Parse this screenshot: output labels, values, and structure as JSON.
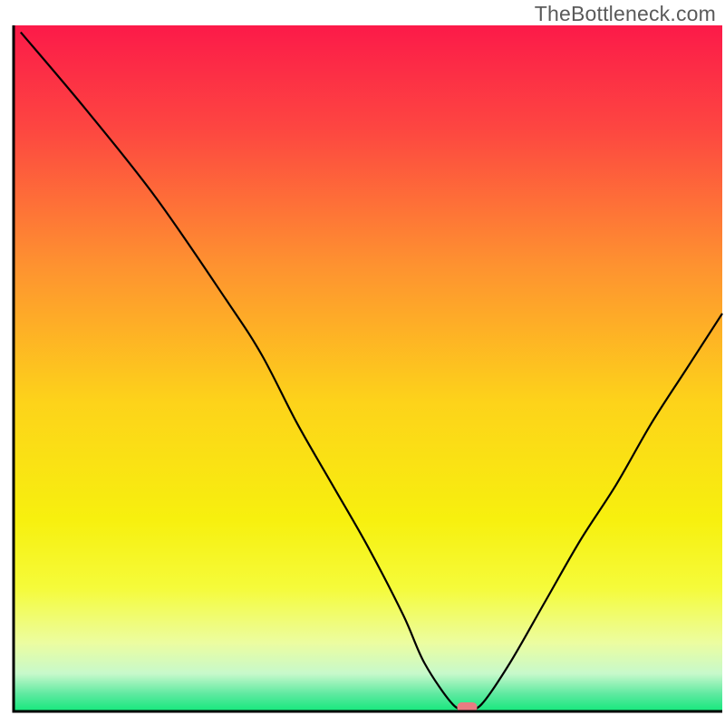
{
  "watermark": "TheBottleneck.com",
  "chart_data": {
    "type": "line",
    "title": "",
    "xlabel": "",
    "ylabel": "",
    "xlim": [
      0,
      100
    ],
    "ylim": [
      0,
      100
    ],
    "grid": false,
    "legend": false,
    "notes": "Background is a vertical gradient from red at top through orange and yellow to green at the very bottom. A single black curve descends from top-left, reaches a flat minimum near x≈62–66 at y≈0, then rises toward the right. A small pink marker sits at the minimum.",
    "series": [
      {
        "name": "curve",
        "x": [
          1,
          10,
          20,
          30,
          35,
          40,
          45,
          50,
          55,
          58,
          62,
          64,
          66,
          70,
          75,
          80,
          85,
          90,
          95,
          100
        ],
        "y": [
          99,
          88,
          75,
          60,
          52,
          42,
          33,
          24,
          14,
          7,
          1,
          0.5,
          1,
          7,
          16,
          25,
          33,
          42,
          50,
          58
        ]
      }
    ],
    "marker": {
      "x": 64,
      "y": 0.6,
      "color": "#e97c82"
    },
    "gradient_stops": [
      {
        "offset": 0.0,
        "color": "#fc1a49"
      },
      {
        "offset": 0.15,
        "color": "#fd4641"
      },
      {
        "offset": 0.35,
        "color": "#fe9230"
      },
      {
        "offset": 0.55,
        "color": "#fdd31a"
      },
      {
        "offset": 0.72,
        "color": "#f7f00e"
      },
      {
        "offset": 0.82,
        "color": "#f5fb3a"
      },
      {
        "offset": 0.9,
        "color": "#ecfda0"
      },
      {
        "offset": 0.945,
        "color": "#c7f9cb"
      },
      {
        "offset": 0.975,
        "color": "#5de9a0"
      },
      {
        "offset": 1.0,
        "color": "#14e87b"
      }
    ],
    "axis_stroke": "#000000",
    "curve_stroke": "#000000"
  }
}
